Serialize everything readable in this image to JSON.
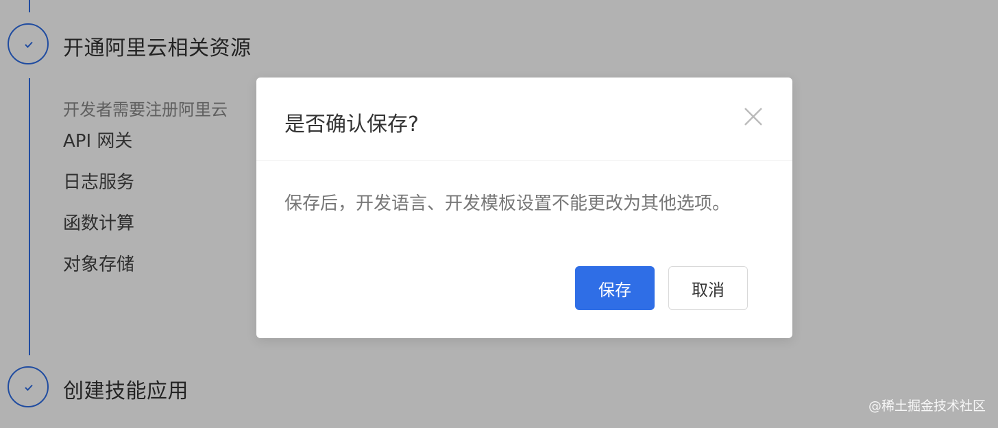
{
  "steps": [
    {
      "title": "开通阿里云相关资源",
      "description": "开发者需要注册阿里云",
      "resources": [
        "API 网关",
        "日志服务",
        "函数计算",
        "对象存储"
      ]
    },
    {
      "title": "创建技能应用"
    }
  ],
  "dialog": {
    "title": "是否确认保存?",
    "message": "保存后，开发语言、开发模板设置不能更改为其他选项。",
    "save_label": "保存",
    "cancel_label": "取消"
  },
  "watermark": "@稀土掘金技术社区",
  "colors": {
    "accent": "#2f6ee6",
    "mask": "rgba(0,0,0,0.30)"
  },
  "icons": {
    "step_status": "check-icon",
    "dialog_close": "close-icon"
  }
}
